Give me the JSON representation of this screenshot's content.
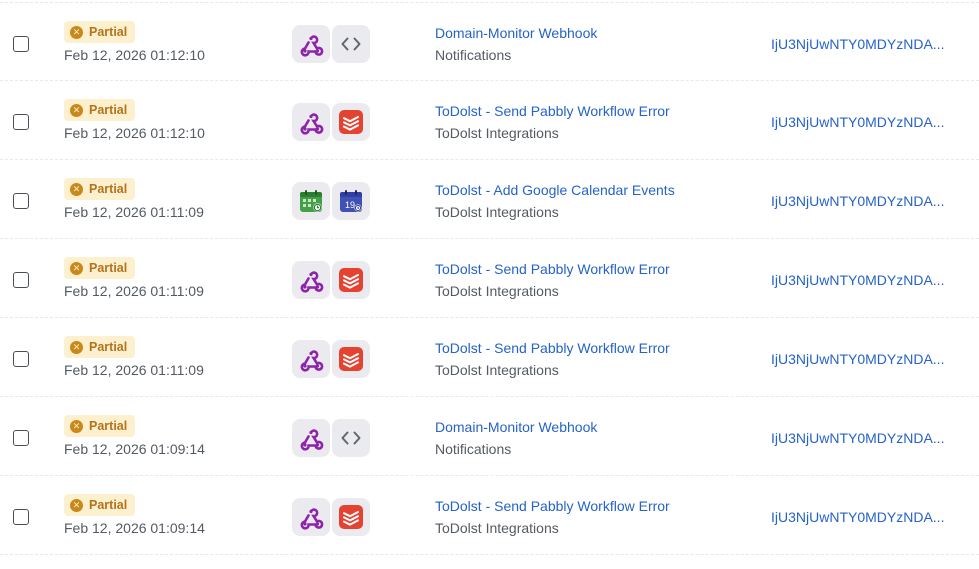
{
  "colors": {
    "partial_badge_bg": "#fdf0cf",
    "partial_badge_text": "#b4731a",
    "link": "#2563c9",
    "muted_text": "#545a63",
    "webhook_purple": "#8e24aa",
    "todoist_red": "#e44332",
    "calendar_green": "#43a047",
    "calendar_blue": "#3f51b5"
  },
  "rows": [
    {
      "status": "Partial",
      "timestamp": "Feb 12, 2026 01:12:10",
      "apps": [
        "webhook-icon",
        "code-icon"
      ],
      "workflow_name": "Domain-Monitor Webhook",
      "folder": "Notifications",
      "task_id": "IjU3NjUwNTY0MDYzNDA..."
    },
    {
      "status": "Partial",
      "timestamp": "Feb 12, 2026 01:12:10",
      "apps": [
        "webhook-icon",
        "todoist-icon"
      ],
      "workflow_name": "ToDolst - Send Pabbly Workflow Error",
      "folder": "ToDolst Integrations",
      "task_id": "IjU3NjUwNTY0MDYzNDA..."
    },
    {
      "status": "Partial",
      "timestamp": "Feb 12, 2026 01:11:09",
      "apps": [
        "calendar-green-icon",
        "calendar-blue-icon"
      ],
      "workflow_name": "ToDolst - Add Google Calendar Events",
      "folder": "ToDolst Integrations",
      "task_id": "IjU3NjUwNTY0MDYzNDA..."
    },
    {
      "status": "Partial",
      "timestamp": "Feb 12, 2026 01:11:09",
      "apps": [
        "webhook-icon",
        "todoist-icon"
      ],
      "workflow_name": "ToDolst - Send Pabbly Workflow Error",
      "folder": "ToDolst Integrations",
      "task_id": "IjU3NjUwNTY0MDYzNDA..."
    },
    {
      "status": "Partial",
      "timestamp": "Feb 12, 2026 01:11:09",
      "apps": [
        "webhook-icon",
        "todoist-icon"
      ],
      "workflow_name": "ToDolst - Send Pabbly Workflow Error",
      "folder": "ToDolst Integrations",
      "task_id": "IjU3NjUwNTY0MDYzNDA..."
    },
    {
      "status": "Partial",
      "timestamp": "Feb 12, 2026 01:09:14",
      "apps": [
        "webhook-icon",
        "code-icon"
      ],
      "workflow_name": "Domain-Monitor Webhook",
      "folder": "Notifications",
      "task_id": "IjU3NjUwNTY0MDYzNDA..."
    },
    {
      "status": "Partial",
      "timestamp": "Feb 12, 2026 01:09:14",
      "apps": [
        "webhook-icon",
        "todoist-icon"
      ],
      "workflow_name": "ToDolst - Send Pabbly Workflow Error",
      "folder": "ToDolst Integrations",
      "task_id": "IjU3NjUwNTY0MDYzNDA..."
    }
  ]
}
